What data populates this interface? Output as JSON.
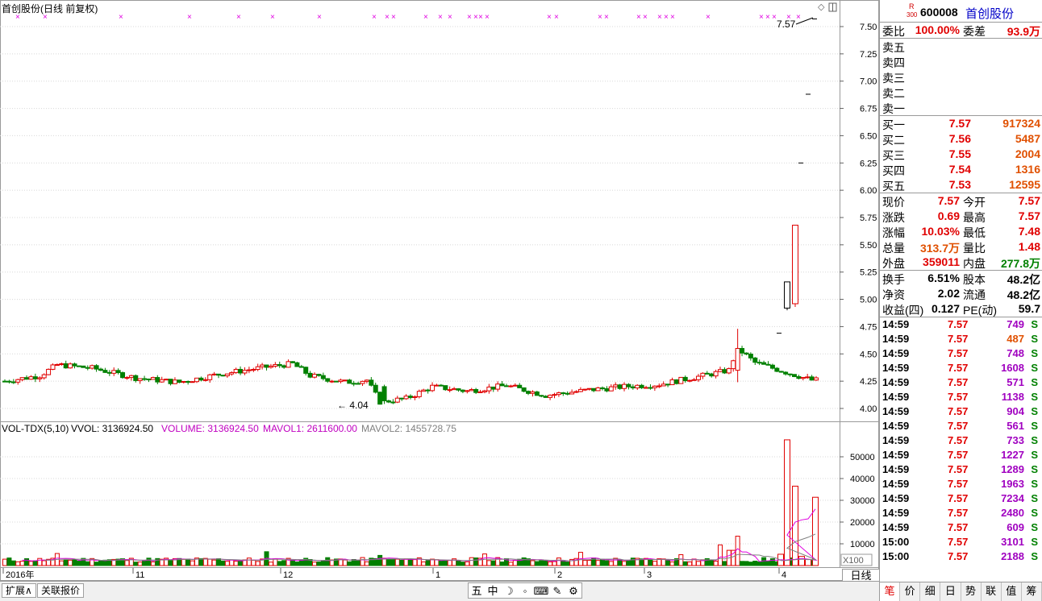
{
  "chart": {
    "title": "首创股份(日线 前复权)",
    "price_ticks": [
      "7.50",
      "7.25",
      "7.00",
      "6.75",
      "6.50",
      "6.25",
      "6.00",
      "5.75",
      "5.50",
      "5.25",
      "5.00",
      "4.75",
      "4.50",
      "4.25",
      "4.00"
    ],
    "high_label": "7.57",
    "low_label": "4.04",
    "vol_header": {
      "name": "VOL-TDX(5,10)",
      "vvol": "VVOL: 3136924.50",
      "volume": "VOLUME: 3136924.50",
      "mavol1": "MAVOL1: 2611600.00",
      "mavol2": "MAVOL2: 1455728.75"
    },
    "vol_ticks": [
      "50000",
      "40000",
      "30000",
      "20000",
      "10000"
    ],
    "vol_unit": "X100",
    "date_labels": [
      "2016年",
      "11",
      "12",
      "1",
      "2",
      "3",
      "4"
    ],
    "period_label": "日线",
    "colors": {
      "up": "#e00000",
      "down": "#008000",
      "mavol1": "#e000e0",
      "mavol2": "#808080",
      "marker": "#e000e0"
    }
  },
  "chart_data": [
    {
      "type": "candlestick",
      "title": "首创股份(日线 前复权)",
      "ylim": [
        3.95,
        7.62
      ],
      "x_start": "2016年",
      "ohlc_sample": [
        {
          "o": 4.28,
          "h": 4.31,
          "l": 4.2,
          "c": 4.22
        },
        {
          "o": 4.22,
          "h": 4.27,
          "l": 4.18,
          "c": 4.25
        },
        {
          "o": 4.25,
          "h": 4.35,
          "l": 4.23,
          "c": 4.33
        },
        {
          "o": 4.33,
          "h": 4.43,
          "l": 4.3,
          "c": 4.38
        },
        {
          "o": 4.38,
          "h": 4.42,
          "l": 4.33,
          "c": 4.36
        },
        {
          "o": 4.36,
          "h": 4.4,
          "l": 4.31,
          "c": 4.34
        },
        {
          "o": 4.34,
          "h": 4.38,
          "l": 4.28,
          "c": 4.3
        },
        {
          "o": 4.3,
          "h": 4.33,
          "l": 4.22,
          "c": 4.26
        },
        {
          "o": 4.26,
          "h": 4.29,
          "l": 4.2,
          "c": 4.24
        },
        {
          "o": 4.24,
          "h": 4.3,
          "l": 4.22,
          "c": 4.28
        },
        {
          "o": 4.28,
          "h": 4.34,
          "l": 4.26,
          "c": 4.32
        },
        {
          "o": 4.32,
          "h": 4.38,
          "l": 4.3,
          "c": 4.36
        },
        {
          "o": 4.36,
          "h": 4.42,
          "l": 4.33,
          "c": 4.4
        },
        {
          "o": 4.4,
          "h": 4.43,
          "l": 4.3,
          "c": 4.33
        },
        {
          "o": 4.33,
          "h": 4.36,
          "l": 4.18,
          "c": 4.22
        },
        {
          "o": 4.22,
          "h": 4.25,
          "l": 4.04,
          "c": 4.08
        },
        {
          "o": 4.08,
          "h": 4.13,
          "l": 4.04,
          "c": 4.1
        },
        {
          "o": 4.1,
          "h": 4.2,
          "l": 4.08,
          "c": 4.18
        },
        {
          "o": 4.18,
          "h": 4.24,
          "l": 4.12,
          "c": 4.15
        },
        {
          "o": 4.15,
          "h": 4.2,
          "l": 4.11,
          "c": 4.17
        },
        {
          "o": 4.17,
          "h": 4.23,
          "l": 4.14,
          "c": 4.21
        },
        {
          "o": 4.21,
          "h": 4.24,
          "l": 4.1,
          "c": 4.13
        },
        {
          "o": 4.13,
          "h": 4.18,
          "l": 4.1,
          "c": 4.16
        },
        {
          "o": 4.16,
          "h": 4.2,
          "l": 4.15,
          "c": 4.19
        },
        {
          "o": 4.19,
          "h": 4.22,
          "l": 4.17,
          "c": 4.2
        },
        {
          "o": 4.2,
          "h": 4.27,
          "l": 4.18,
          "c": 4.25
        },
        {
          "o": 4.25,
          "h": 4.33,
          "l": 4.23,
          "c": 4.3
        },
        {
          "o": 4.3,
          "h": 4.38,
          "l": 4.27,
          "c": 4.35
        },
        {
          "o": 4.35,
          "h": 4.73,
          "l": 4.26,
          "c": 4.55
        },
        {
          "o": 4.55,
          "h": 4.6,
          "l": 4.4,
          "c": 4.44
        },
        {
          "o": 4.44,
          "h": 4.47,
          "l": 4.33,
          "c": 4.37
        },
        {
          "o": 4.37,
          "h": 4.4,
          "l": 4.3,
          "c": 4.34
        },
        {
          "o": 4.34,
          "h": 4.36,
          "l": 4.28,
          "c": 4.3
        },
        {
          "o": 4.3,
          "h": 4.32,
          "l": 4.24,
          "c": 4.26
        },
        {
          "o": 4.69,
          "h": 4.69,
          "l": 4.69,
          "c": 4.69
        },
        {
          "o": 4.92,
          "h": 5.16,
          "l": 4.9,
          "c": 5.16
        },
        {
          "o": 4.96,
          "h": 5.68,
          "l": 4.93,
          "c": 5.68
        },
        {
          "o": 6.25,
          "h": 6.25,
          "l": 6.25,
          "c": 6.25
        },
        {
          "o": 6.88,
          "h": 6.88,
          "l": 6.88,
          "c": 6.88
        },
        {
          "o": 7.57,
          "h": 7.57,
          "l": 7.57,
          "c": 7.57
        }
      ],
      "annotations": {
        "high": "7.57",
        "low": "4.04"
      }
    },
    {
      "type": "bar",
      "title": "VOL-TDX(5,10)",
      "ylabel": "X100",
      "ylim": [
        0,
        60000
      ],
      "series": [
        {
          "name": "VOLUME",
          "last": 3136924.5
        },
        {
          "name": "MAVOL1",
          "last": 2611600.0
        },
        {
          "name": "MAVOL2",
          "last": 1455728.75
        }
      ],
      "recent_values": [
        5200,
        57800,
        36500,
        4200,
        2800,
        31400
      ]
    }
  ],
  "quote": {
    "code": "600008",
    "name": "首创股份",
    "badge_r": "R",
    "badge_300": "300",
    "weibi_label": "委比",
    "weibi": "100.00%",
    "weicha_label": "委差",
    "weicha": "93.9万",
    "sells": [
      {
        "label": "卖五"
      },
      {
        "label": "卖四"
      },
      {
        "label": "卖三"
      },
      {
        "label": "卖二"
      },
      {
        "label": "卖一"
      }
    ],
    "buys": [
      {
        "label": "买一",
        "price": "7.57",
        "vol": "917324"
      },
      {
        "label": "买二",
        "price": "7.56",
        "vol": "5487"
      },
      {
        "label": "买三",
        "price": "7.55",
        "vol": "2004"
      },
      {
        "label": "买四",
        "price": "7.54",
        "vol": "1316"
      },
      {
        "label": "买五",
        "price": "7.53",
        "vol": "12595"
      }
    ],
    "stats1": [
      {
        "l1": "现价",
        "v1": "7.57",
        "l2": "今开",
        "v2": "7.57"
      },
      {
        "l1": "涨跌",
        "v1": "0.69",
        "l2": "最高",
        "v2": "7.57"
      },
      {
        "l1": "涨幅",
        "v1": "10.03%",
        "l2": "最低",
        "v2": "7.48"
      },
      {
        "l1": "总量",
        "v1": "313.7万",
        "l2": "量比",
        "v2": "1.48"
      },
      {
        "l1": "外盘",
        "v1": "359011",
        "l2": "内盘",
        "v2": "277.8万"
      }
    ],
    "stats2": [
      {
        "l1": "换手",
        "v1": "6.51%",
        "l2": "股本",
        "v2": "48.2亿"
      },
      {
        "l1": "净资",
        "v1": "2.02",
        "l2": "流通",
        "v2": "48.2亿"
      },
      {
        "l1": "收益(四)",
        "v1": "0.127",
        "l2": "PE(动)",
        "v2": "59.7"
      }
    ],
    "ticks": [
      {
        "t": "14:59",
        "p": "7.57",
        "v": "749",
        "s": "S",
        "c": "purple"
      },
      {
        "t": "14:59",
        "p": "7.57",
        "v": "487",
        "s": "S",
        "c": "orange"
      },
      {
        "t": "14:59",
        "p": "7.57",
        "v": "748",
        "s": "S",
        "c": "purple"
      },
      {
        "t": "14:59",
        "p": "7.57",
        "v": "1608",
        "s": "S",
        "c": "purple"
      },
      {
        "t": "14:59",
        "p": "7.57",
        "v": "571",
        "s": "S",
        "c": "purple"
      },
      {
        "t": "14:59",
        "p": "7.57",
        "v": "1138",
        "s": "S",
        "c": "purple"
      },
      {
        "t": "14:59",
        "p": "7.57",
        "v": "904",
        "s": "S",
        "c": "purple"
      },
      {
        "t": "14:59",
        "p": "7.57",
        "v": "561",
        "s": "S",
        "c": "purple"
      },
      {
        "t": "14:59",
        "p": "7.57",
        "v": "733",
        "s": "S",
        "c": "purple"
      },
      {
        "t": "14:59",
        "p": "7.57",
        "v": "1227",
        "s": "S",
        "c": "purple"
      },
      {
        "t": "14:59",
        "p": "7.57",
        "v": "1289",
        "s": "S",
        "c": "purple"
      },
      {
        "t": "14:59",
        "p": "7.57",
        "v": "1963",
        "s": "S",
        "c": "purple"
      },
      {
        "t": "14:59",
        "p": "7.57",
        "v": "7234",
        "s": "S",
        "c": "purple"
      },
      {
        "t": "14:59",
        "p": "7.57",
        "v": "2480",
        "s": "S",
        "c": "purple"
      },
      {
        "t": "14:59",
        "p": "7.57",
        "v": "609",
        "s": "S",
        "c": "purple"
      },
      {
        "t": "15:00",
        "p": "7.57",
        "v": "3101",
        "s": "S",
        "c": "purple"
      },
      {
        "t": "15:00",
        "p": "7.57",
        "v": "2188",
        "s": "S",
        "c": "purple"
      }
    ],
    "tabs": [
      "笔",
      "价",
      "细",
      "日",
      "势",
      "联",
      "值",
      "筹"
    ]
  },
  "bottom": {
    "tab1": "扩展∧",
    "tab2": "关联报价",
    "tools": [
      "五",
      "中",
      "☽",
      "◦",
      "⌨",
      "✎",
      "⚙"
    ]
  }
}
